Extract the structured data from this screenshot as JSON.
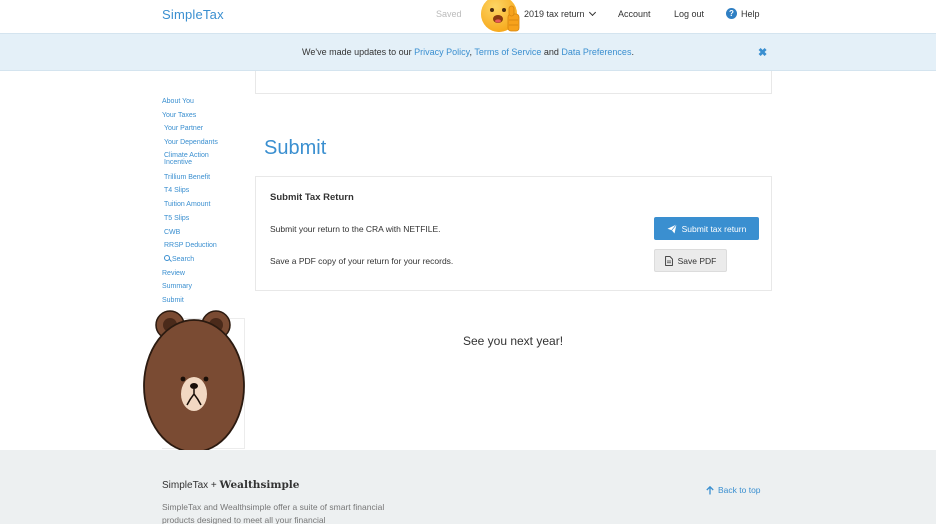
{
  "header": {
    "logo": "SimpleTax",
    "saved": "Saved",
    "tax_year": "2019 tax return",
    "account": "Account",
    "logout": "Log out",
    "help": "Help",
    "help_icon_glyph": "?"
  },
  "banner": {
    "prefix": "We've made updates to our ",
    "privacy": "Privacy Policy",
    "comma": ", ",
    "terms": "Terms of Service",
    "and": " and ",
    "data_prefs": "Data Preferences",
    "suffix": ".",
    "close_glyph": "✖"
  },
  "sidebar": {
    "items": [
      {
        "label": "About You",
        "sub": false
      },
      {
        "label": "Your Taxes",
        "sub": false
      },
      {
        "label": "Your Partner",
        "sub": true
      },
      {
        "label": "Your Dependants",
        "sub": true
      },
      {
        "label": "Climate Action Incentive",
        "sub": true
      },
      {
        "label": "Trillium Benefit",
        "sub": true
      },
      {
        "label": "T4 Slips",
        "sub": true
      },
      {
        "label": "Tuition Amount",
        "sub": true
      },
      {
        "label": "T5 Slips",
        "sub": true
      },
      {
        "label": "CWB",
        "sub": true
      },
      {
        "label": "RRSP Deduction",
        "sub": true
      },
      {
        "label": "Search",
        "sub": true
      },
      {
        "label": "Review",
        "sub": false
      },
      {
        "label": "Summary",
        "sub": false
      },
      {
        "label": "Submit",
        "sub": false
      }
    ]
  },
  "main": {
    "title": "Submit",
    "card_heading": "Submit Tax Return",
    "netfile_text": "Submit your return to the CRA with NETFILE.",
    "pdf_text": "Save a PDF copy of your return for your records.",
    "submit_button": "Submit tax return",
    "save_pdf_button": "Save PDF",
    "farewell": "See you next year!"
  },
  "footer": {
    "brand_simple": "SimpleTax",
    "brand_plus": " + ",
    "brand_wealth": "Wealthsimple",
    "description": "SimpleTax and Wealthsimple offer a suite of smart financial products designed to meet all your financial",
    "back_to_top": "Back to top"
  },
  "colors": {
    "accent": "#3a8fd0",
    "banner_bg": "#e4f0f8",
    "footer_bg": "#edf0f1",
    "bear_brown": "#7a4b33"
  },
  "icons": [
    "chevron-down-icon",
    "help-icon",
    "close-icon",
    "send-icon",
    "file-icon",
    "search-icon",
    "arrow-up-icon",
    "emoji-thumbs-up-sticker",
    "bear-sticker"
  ]
}
